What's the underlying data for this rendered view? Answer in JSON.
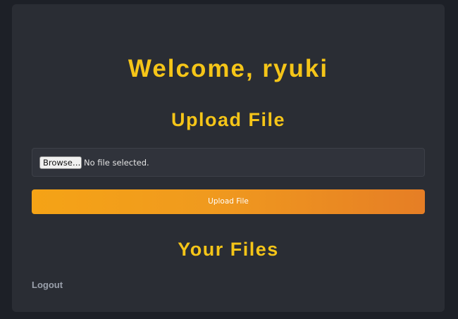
{
  "greeting": "Welcome, ryuki",
  "upload": {
    "title": "Upload File",
    "browse_label": "Browse…",
    "no_file_text": "No file selected.",
    "submit_label": "Upload File"
  },
  "files": {
    "title": "Your Files"
  },
  "logout_label": "Logout",
  "colors": {
    "background": "#1d2027",
    "card": "#2a2d34",
    "heading": "#f5c518",
    "button_start": "#f5a316",
    "button_end": "#e67e25"
  }
}
